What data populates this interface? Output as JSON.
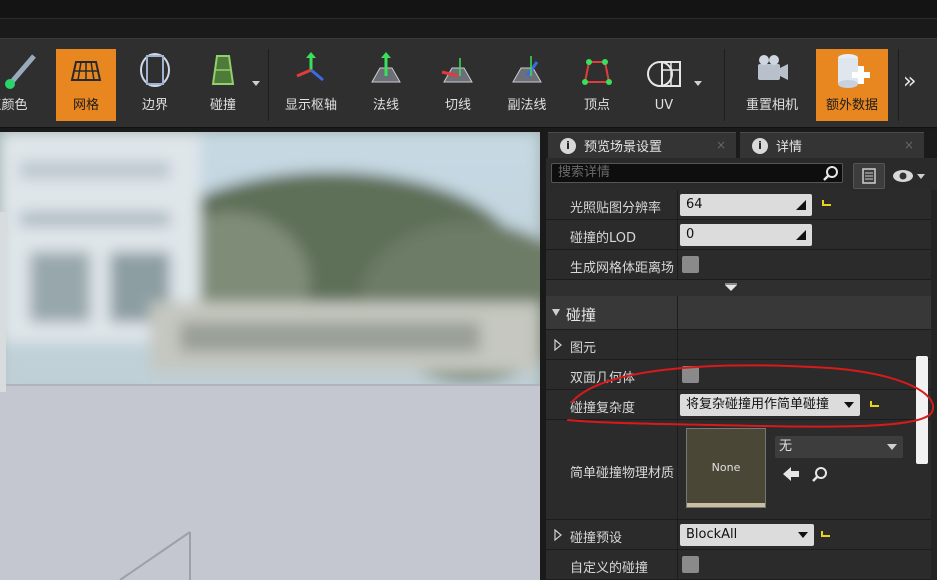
{
  "toolbar": {
    "items": [
      {
        "label": "点颜色",
        "icon": "vertex-color-icon"
      },
      {
        "label": "网格",
        "icon": "grid-icon"
      },
      {
        "label": "边界",
        "icon": "bounds-icon"
      },
      {
        "label": "碰撞",
        "icon": "collision-icon"
      },
      {
        "label": "显示枢轴",
        "icon": "pivot-icon"
      },
      {
        "label": "法线",
        "icon": "normals-icon"
      },
      {
        "label": "切线",
        "icon": "tangents-icon"
      },
      {
        "label": "副法线",
        "icon": "binormals-icon"
      },
      {
        "label": "顶点",
        "icon": "vertices-icon"
      },
      {
        "label": "UV",
        "icon": "uv-icon"
      },
      {
        "label": "重置相机",
        "icon": "reset-camera-icon"
      },
      {
        "label": "额外数据",
        "icon": "additional-data-icon"
      }
    ],
    "more_label": "»"
  },
  "tabs": [
    {
      "label": "预览场景设置",
      "close": "×"
    },
    {
      "label": "详情",
      "close": "×"
    }
  ],
  "search": {
    "placeholder": "搜索详情"
  },
  "properties": {
    "lightmap_resolution": {
      "label": "光照贴图分辨率",
      "value": "64"
    },
    "collision_lod": {
      "label": "碰撞的LOD",
      "value": "0"
    },
    "distance_field": {
      "label": "生成网格体距离场"
    },
    "collision_section": {
      "label": "碰撞"
    },
    "primitives": {
      "label": "图元"
    },
    "double_sided": {
      "label": "双面几何体"
    },
    "complexity": {
      "label": "碰撞复杂度",
      "value": "将复杂碰撞用作简单碰撞"
    },
    "simple_material": {
      "label": "简单碰撞物理材质",
      "thumb": "None",
      "value": "无"
    },
    "preset": {
      "label": "碰撞预设",
      "value": "BlockAll"
    },
    "custom": {
      "label": "自定义的碰撞"
    }
  },
  "colors": {
    "accent": "#e8861f",
    "annotation": "#d81a1a"
  }
}
